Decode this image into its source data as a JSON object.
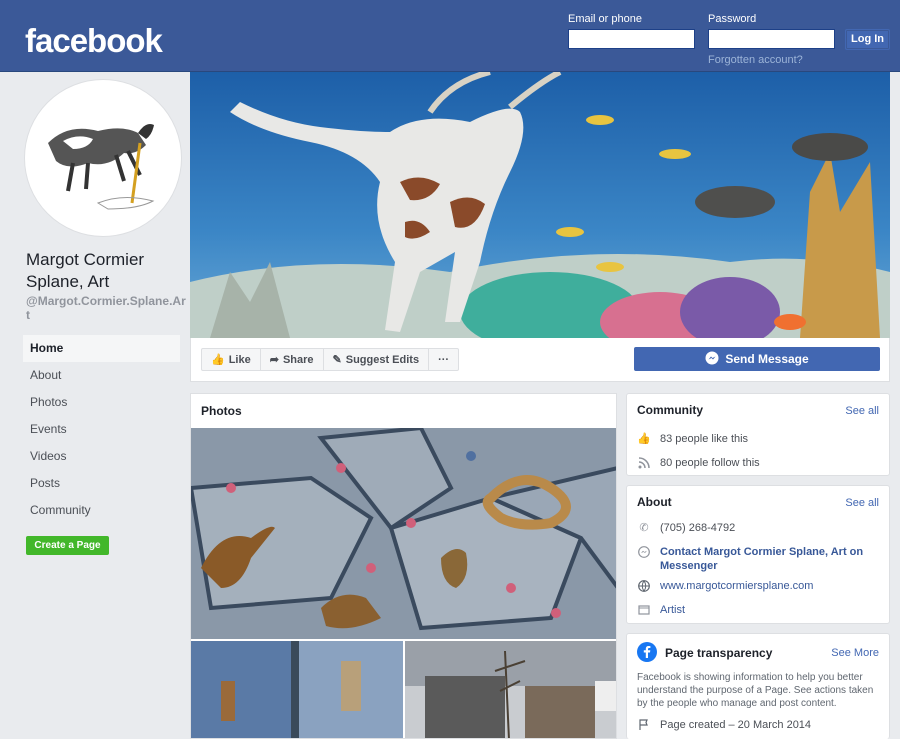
{
  "header": {
    "logo": "facebook",
    "email_label": "Email or phone",
    "password_label": "Password",
    "login_button": "Log In",
    "forgot_link": "Forgotten account?",
    "colors": {
      "bar": "#3b5998",
      "button": "#4267b2"
    }
  },
  "sidebar": {
    "page_name": "Margot Cormier Splane, Art",
    "handle": "@Margot.Cormier.Splane.Art",
    "nav": [
      "Home",
      "About",
      "Photos",
      "Events",
      "Videos",
      "Posts",
      "Community"
    ],
    "create_page": "Create a Page"
  },
  "actions": {
    "like": "Like",
    "share": "Share",
    "suggest": "Suggest Edits",
    "more": "···",
    "send_message": "Send Message"
  },
  "photos": {
    "title": "Photos"
  },
  "community": {
    "title": "Community",
    "see_all": "See all",
    "likes": "83 people like this",
    "follows": "80 people follow this"
  },
  "about": {
    "title": "About",
    "see_all": "See all",
    "phone": "(705) 268-4792",
    "messenger": "Contact Margot Cormier Splane, Art on Messenger",
    "website": "www.margotcormiersplane.com",
    "category": "Artist"
  },
  "transparency": {
    "title": "Page transparency",
    "see_more": "See More",
    "description": "Facebook is showing information to help you better understand the purpose of a Page. See actions taken by the people who manage and post content.",
    "created": "Page created – 20 March 2014"
  }
}
